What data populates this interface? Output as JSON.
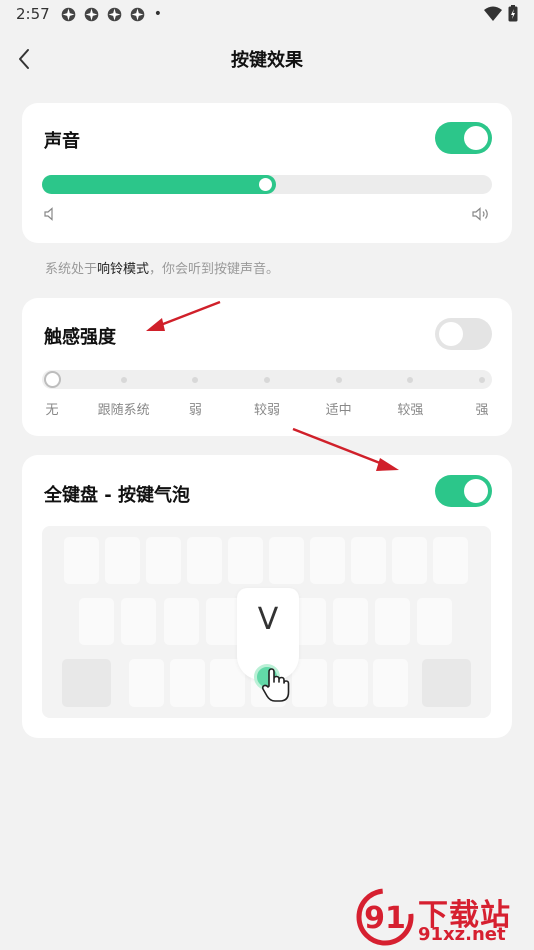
{
  "status_bar": {
    "time": "2:57",
    "dot": "•"
  },
  "header": {
    "title": "按键效果"
  },
  "sound_card": {
    "title": "声音",
    "toggle_on": true,
    "volume_level": 0.52
  },
  "note": {
    "prefix": "系统处于",
    "mode": "响铃模式",
    "suffix": "，你会听到按键声音。"
  },
  "haptic_card": {
    "title": "触感强度",
    "toggle_on": false,
    "levels": [
      "无",
      "跟随系统",
      "弱",
      "较弱",
      "适中",
      "较强",
      "强"
    ],
    "selected_index": 0
  },
  "bubble_card": {
    "title": "全键盘 - 按键气泡",
    "toggle_on": true,
    "bubble_letter": "V"
  },
  "watermark": {
    "line1": "下载站",
    "line2": "91xz.net"
  },
  "colors": {
    "accent": "#2cc68a",
    "arrow": "#d0202a",
    "watermark": "#d62030"
  }
}
